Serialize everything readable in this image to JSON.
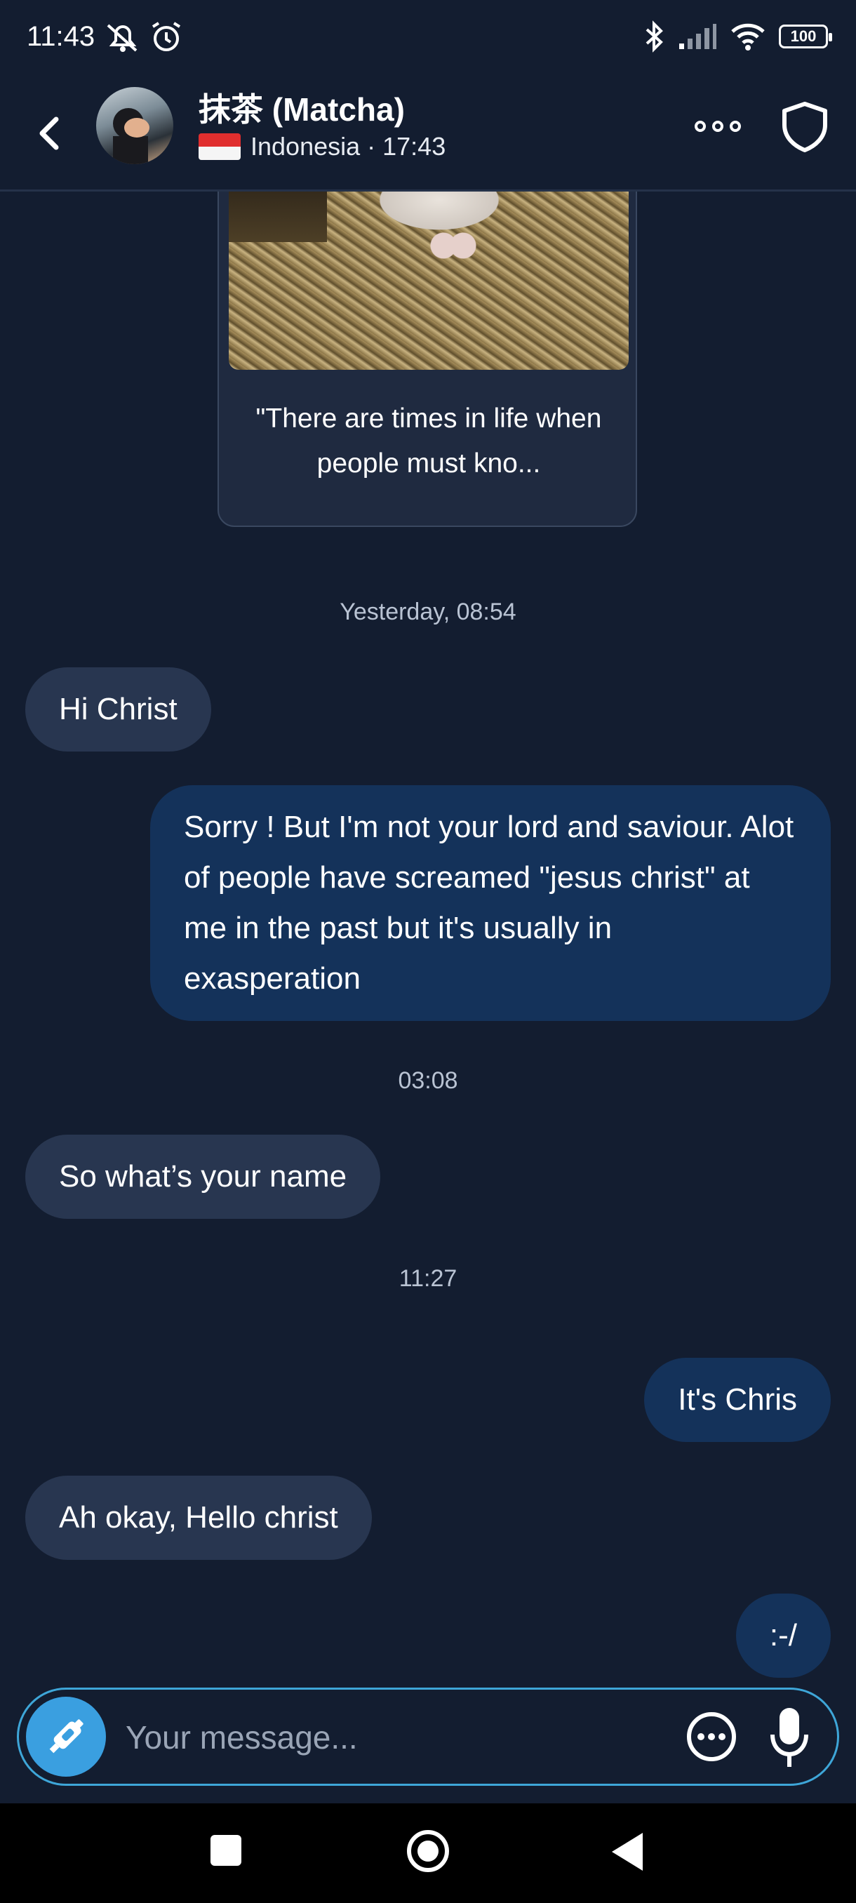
{
  "status_bar": {
    "time": "11:43",
    "battery": "100",
    "icons": [
      "notifications-off-icon",
      "alarm-icon",
      "bluetooth-icon",
      "signal-icon",
      "wifi-icon",
      "battery-icon"
    ]
  },
  "header": {
    "contact_name": "抹茶 (Matcha)",
    "country": "Indonesia",
    "local_time": "17:43",
    "meta": "Indonesia · 17:43",
    "flag": "indonesia-flag"
  },
  "chat": {
    "card_text": "\"There are times in life when people must kno...",
    "messages": [
      {
        "type": "timestamp",
        "text": "Yesterday, 08:54"
      },
      {
        "type": "incoming",
        "text": "Hi Christ"
      },
      {
        "type": "outgoing",
        "text": "Sorry ! But I'm not your lord and saviour. Alot of people have screamed \"jesus christ\" at me in the past but it's usually in exasperation"
      },
      {
        "type": "timestamp",
        "text": "03:08"
      },
      {
        "type": "incoming",
        "text": "So what’s your name"
      },
      {
        "type": "timestamp",
        "text": "11:27"
      },
      {
        "type": "outgoing",
        "text": "It's Chris"
      },
      {
        "type": "incoming",
        "text": "Ah okay, Hello christ"
      },
      {
        "type": "outgoing",
        "text": ":-/"
      }
    ]
  },
  "composer": {
    "placeholder": "Your message..."
  },
  "colors": {
    "background": "#131d30",
    "incoming_bubble": "#283650",
    "outgoing_bubble": "#14325a",
    "accent": "#3a9fe0",
    "composer_border": "#3ea6d8"
  }
}
